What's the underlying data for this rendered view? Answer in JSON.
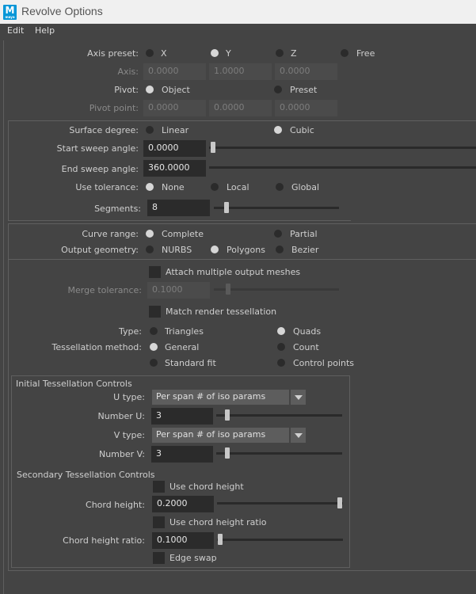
{
  "window": {
    "title": "Revolve Options",
    "app_icon_letter": "M",
    "app_icon_sub": "maya",
    "app_icon_color": "#0696d7"
  },
  "menu": {
    "items": [
      "Edit",
      "Help"
    ]
  },
  "axis_preset": {
    "label": "Axis preset:",
    "options": [
      "X",
      "Y",
      "Z",
      "Free"
    ],
    "selected": "Y"
  },
  "axis": {
    "label": "Axis:",
    "values": [
      "0.0000",
      "1.0000",
      "0.0000"
    ]
  },
  "pivot": {
    "label": "Pivot:",
    "options": [
      "Object",
      "Preset"
    ],
    "selected": "Object"
  },
  "pivot_point": {
    "label": "Pivot point:",
    "values": [
      "0.0000",
      "0.0000",
      "0.0000"
    ]
  },
  "surface_degree": {
    "label": "Surface degree:",
    "options": [
      "Linear",
      "Cubic"
    ],
    "selected": "Cubic"
  },
  "start_sweep": {
    "label": "Start sweep angle:",
    "value": "0.0000"
  },
  "end_sweep": {
    "label": "End sweep angle:",
    "value": "360.0000"
  },
  "use_tolerance": {
    "label": "Use tolerance:",
    "options": [
      "None",
      "Local",
      "Global"
    ],
    "selected": "None"
  },
  "segments": {
    "label": "Segments:",
    "value": "8"
  },
  "curve_range": {
    "label": "Curve range:",
    "options": [
      "Complete",
      "Partial"
    ],
    "selected": "Complete"
  },
  "output_geometry": {
    "label": "Output geometry:",
    "options": [
      "NURBS",
      "Polygons",
      "Bezier"
    ],
    "selected": "Polygons"
  },
  "attach_meshes": {
    "label": "Attach multiple output meshes"
  },
  "merge_tolerance": {
    "label": "Merge tolerance:",
    "value": "0.1000"
  },
  "match_render": {
    "label": "Match render tessellation"
  },
  "type": {
    "label": "Type:",
    "options": [
      "Triangles",
      "Quads"
    ],
    "selected": "Quads"
  },
  "tess_method": {
    "label": "Tessellation method:",
    "options": [
      "General",
      "Count",
      "Standard fit",
      "Control points"
    ],
    "selected": "General"
  },
  "initial_group": {
    "title": "Initial Tessellation Controls",
    "u_type_label": "U type:",
    "u_type_value": "Per span # of iso params",
    "number_u_label": "Number U:",
    "number_u_value": "3",
    "v_type_label": "V type:",
    "v_type_value": "Per span # of iso params",
    "number_v_label": "Number V:",
    "number_v_value": "3"
  },
  "secondary_group": {
    "title": "Secondary Tessellation Controls",
    "use_chord_height": "Use chord height",
    "chord_height_label": "Chord height:",
    "chord_height_value": "0.2000",
    "use_chord_ratio": "Use chord height ratio",
    "chord_ratio_label": "Chord height ratio:",
    "chord_ratio_value": "0.1000",
    "edge_swap": "Edge swap"
  }
}
